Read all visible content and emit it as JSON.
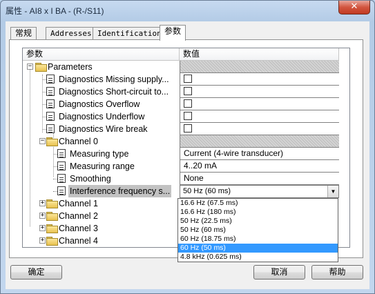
{
  "window": {
    "title": "属性 - AI8 x I BA - (R-/S11)",
    "close_symbol": "✕"
  },
  "tabs": [
    {
      "label": "常规"
    },
    {
      "label": "Addresses"
    },
    {
      "label": "Identification"
    },
    {
      "label": "参数",
      "active": true
    }
  ],
  "grid": {
    "col_param": "参数",
    "col_value": "数值",
    "rows": [
      {
        "label": "Parameters",
        "value": "",
        "kind": "hatched"
      },
      {
        "label": "Diagnostics Missing supply...",
        "value": "",
        "kind": "checkbox"
      },
      {
        "label": "Diagnostics Short-circuit to...",
        "value": "",
        "kind": "checkbox"
      },
      {
        "label": "Diagnostics Overflow",
        "value": "",
        "kind": "checkbox"
      },
      {
        "label": "Diagnostics Underflow",
        "value": "",
        "kind": "checkbox"
      },
      {
        "label": "Diagnostics Wire break",
        "value": "",
        "kind": "checkbox"
      },
      {
        "label": "Channel 0",
        "value": "",
        "kind": "hatched"
      },
      {
        "label": "Measuring type",
        "value": "Current (4-wire transducer)",
        "kind": "text"
      },
      {
        "label": "Measuring range",
        "value": "4..20 mA",
        "kind": "text"
      },
      {
        "label": "Smoothing",
        "value": "None",
        "kind": "text"
      },
      {
        "label": "Interference frequency s...",
        "value": "50 Hz (60 ms)",
        "kind": "combo"
      },
      {
        "label": "Channel 1"
      },
      {
        "label": "Channel 2"
      },
      {
        "label": "Channel 3"
      },
      {
        "label": "Channel 4"
      }
    ],
    "expander_collapsed": "+",
    "expander_expanded": "−",
    "combo_arrow": "▼"
  },
  "dropdown": {
    "options": [
      "16.6 Hz (67.5 ms)",
      "16.6 Hz (180 ms)",
      "50 Hz (22.5 ms)",
      "50 Hz (60 ms)",
      "60 Hz (18.75 ms)",
      "60 Hz (50 ms)",
      "4.8 kHz (0.625 ms)"
    ],
    "selected_index": 5
  },
  "scrollbar": {
    "up": "▲",
    "down": "▼"
  },
  "buttons": {
    "ok": "确定",
    "cancel": "取消",
    "help": "帮助"
  }
}
